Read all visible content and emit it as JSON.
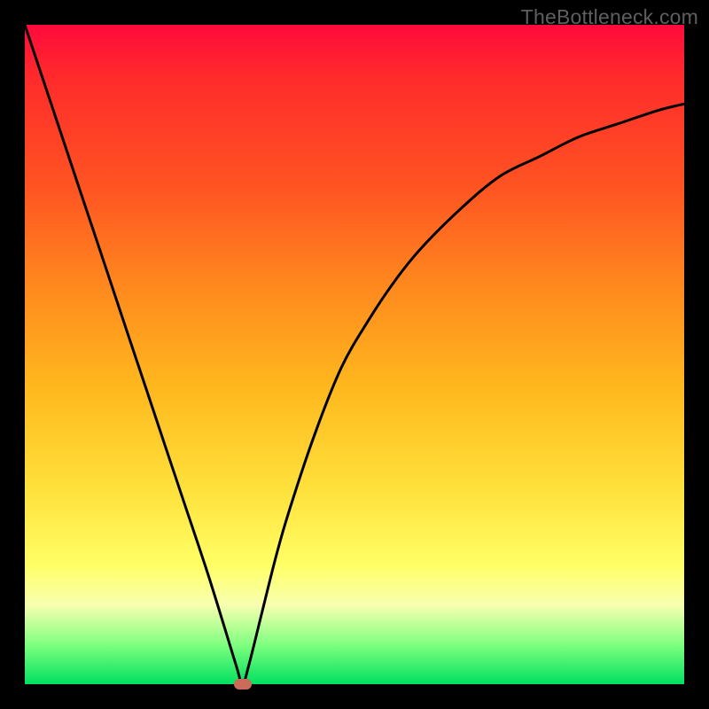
{
  "watermark": "TheBottleneck.com",
  "colors": {
    "frame": "#000000",
    "curve": "#000000",
    "marker": "#cc6b5a",
    "gradient_top": "#ff0a3c",
    "gradient_bottom": "#00e060"
  },
  "chart_data": {
    "type": "line",
    "title": "",
    "xlabel": "",
    "ylabel": "",
    "xlim": [
      0,
      100
    ],
    "ylim": [
      0,
      100
    ],
    "grid": false,
    "legend": false,
    "minimum_point": {
      "x": 33,
      "y": 0
    },
    "series": [
      {
        "name": "bottleneck-curve",
        "x": [
          0,
          4,
          8,
          12,
          16,
          20,
          24,
          28,
          32,
          33,
          34,
          36,
          38,
          40,
          44,
          48,
          52,
          56,
          60,
          66,
          72,
          78,
          84,
          90,
          96,
          100
        ],
        "values": [
          100,
          88,
          76,
          64,
          52,
          40,
          28,
          16,
          3,
          0,
          3,
          11,
          19,
          26,
          38,
          48,
          55,
          61,
          66,
          72,
          77,
          80,
          83,
          85,
          87,
          88
        ]
      }
    ]
  }
}
